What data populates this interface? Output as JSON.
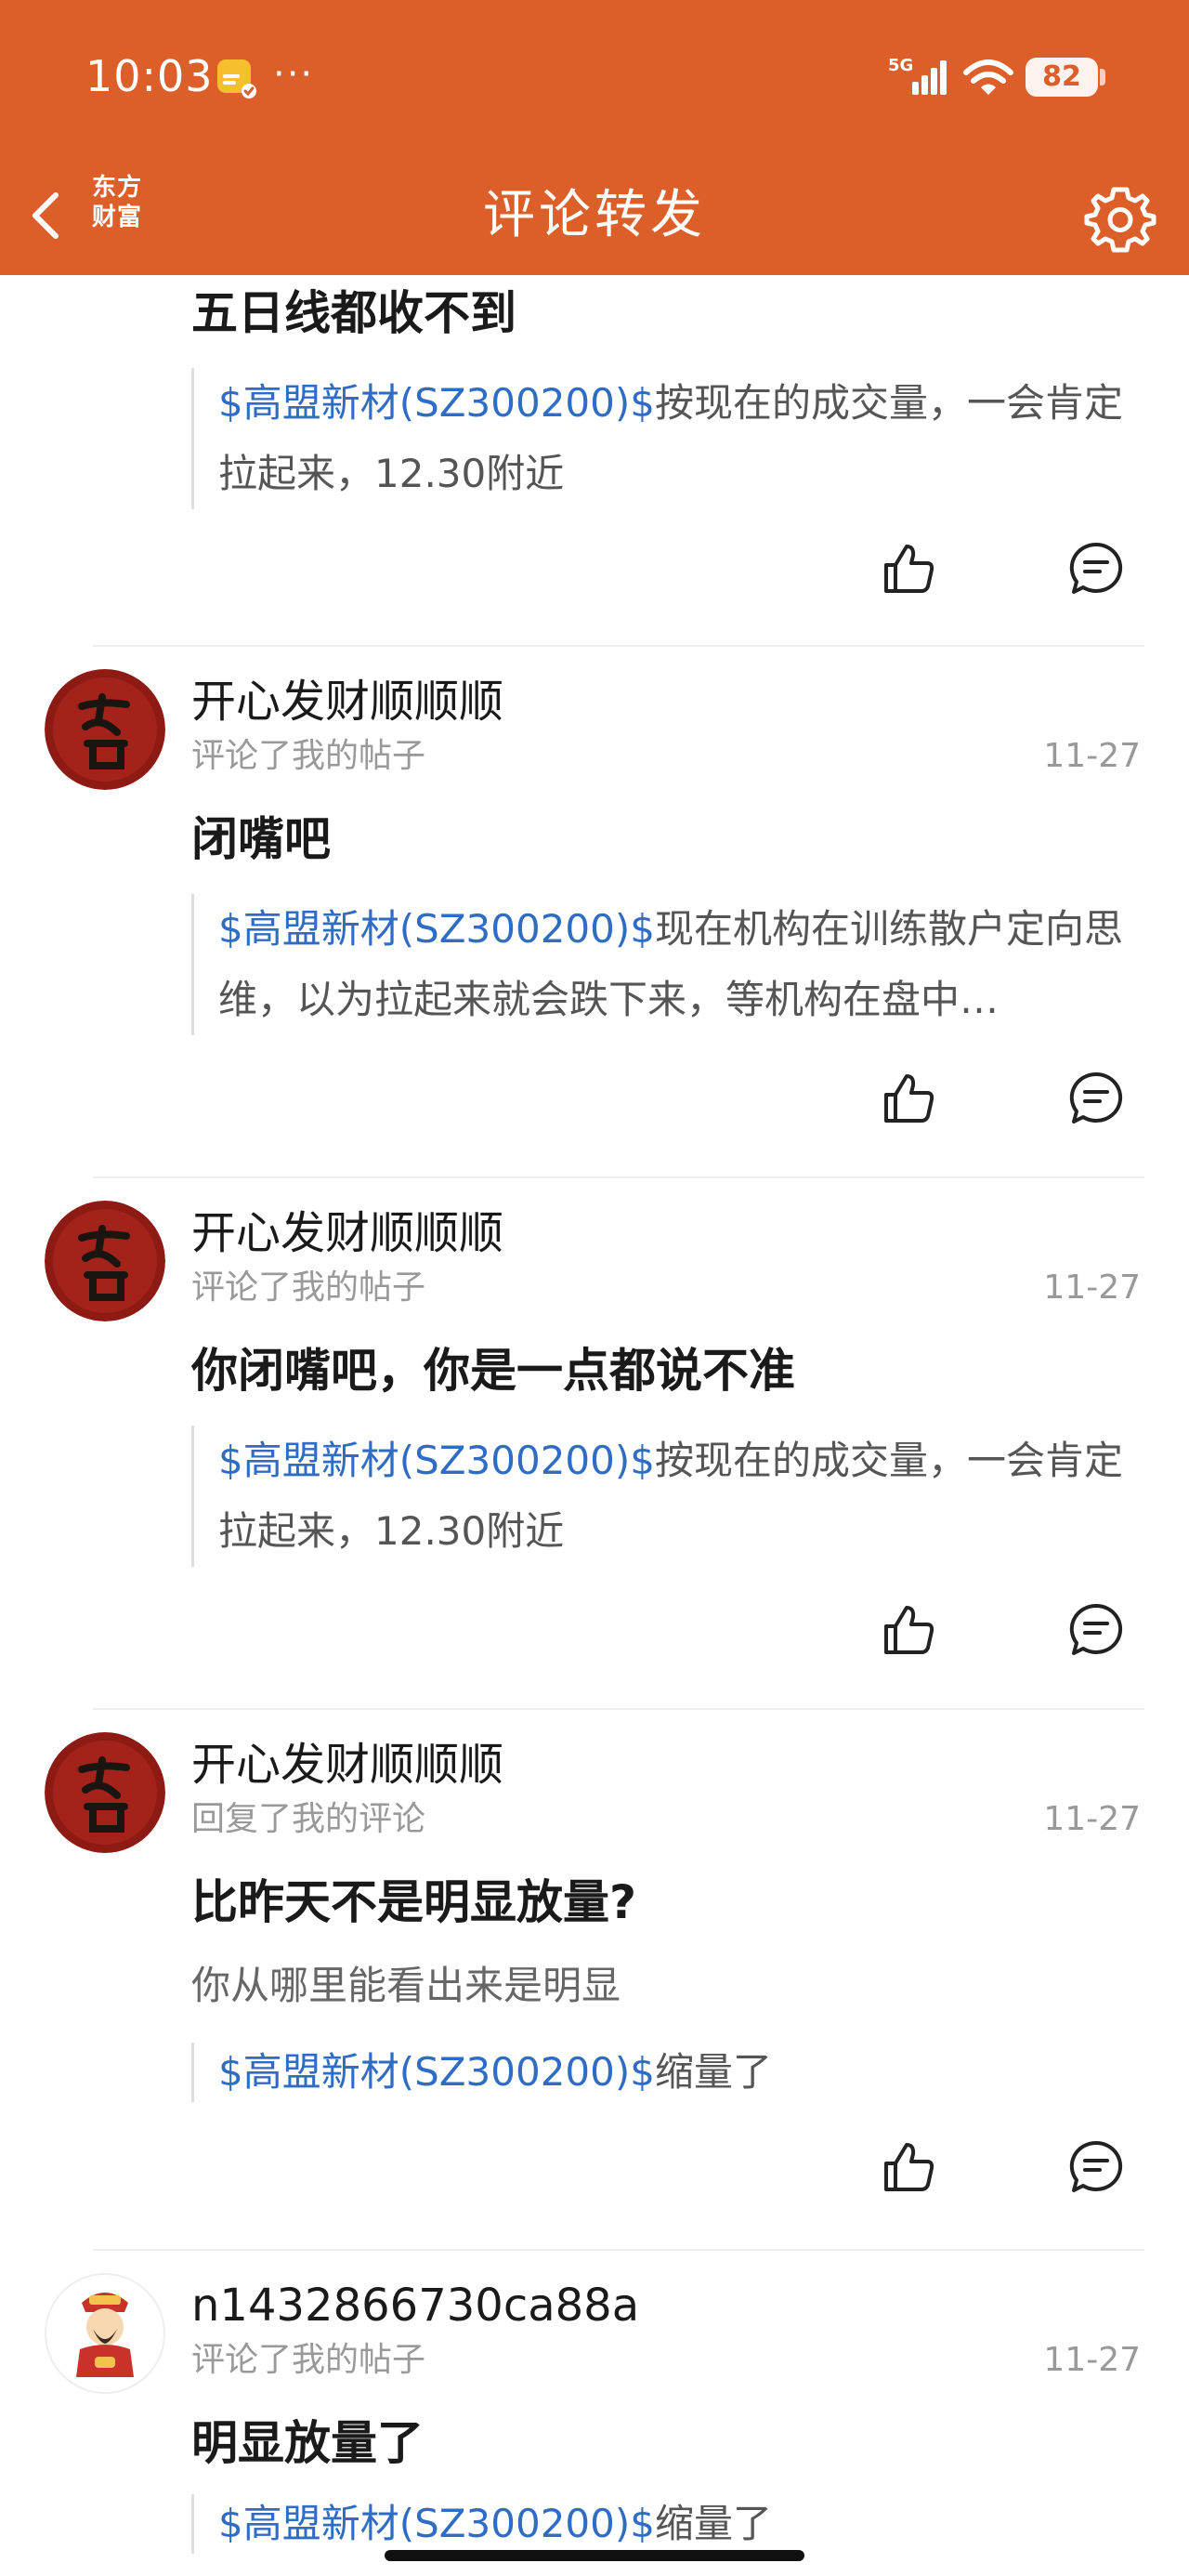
{
  "status_bar": {
    "time": "10:03",
    "more": "···",
    "network": "5G",
    "battery": "82"
  },
  "nav": {
    "title": "评论转发",
    "brand_line1": "东方",
    "brand_line2": "财富"
  },
  "colors": {
    "brand_orange": "#DC5F2A",
    "stock_link_blue": "#2F6CC4",
    "text_dark": "#1A1A1A",
    "text_grey": "#999999"
  },
  "items": [
    {
      "comment": "五日线都收不到",
      "quote_stock": "$高盟新材(SZ300200)$",
      "quote_text": "按现在的成交量，一会肯定拉起来，12.30附近"
    },
    {
      "username": "开心发财顺顺顺",
      "action": "评论了我的帖子",
      "date": "11-27",
      "comment": "闭嘴吧",
      "quote_stock": "$高盟新材(SZ300200)$",
      "quote_text": "现在机构在训练散户定向思维，以为拉起来就会跌下来，等机构在盘中…"
    },
    {
      "username": "开心发财顺顺顺",
      "action": "评论了我的帖子",
      "date": "11-27",
      "comment": "你闭嘴吧，你是一点都说不准",
      "quote_stock": "$高盟新材(SZ300200)$",
      "quote_text": "按现在的成交量，一会肯定拉起来，12.30附近"
    },
    {
      "username": "开心发财顺顺顺",
      "action": "回复了我的评论",
      "date": "11-27",
      "comment": "比昨天不是明显放量?",
      "reply_text": "你从哪里能看出来是明显",
      "quote_stock": "$高盟新材(SZ300200)$",
      "quote_text": "缩量了"
    },
    {
      "username": "n1432866730ca88a",
      "action": "评论了我的帖子",
      "date": "11-27",
      "comment": "明显放量了",
      "quote_stock": "$高盟新材(SZ300200)$",
      "quote_text": "缩量了"
    }
  ],
  "icons": {
    "back": "chevron-left-icon",
    "settings": "gear-icon",
    "like": "thumbs-up-icon",
    "reply": "comment-bubble-icon",
    "signal": "cellular-signal-icon",
    "wifi": "wifi-icon",
    "notification": "app-notification-icon"
  }
}
